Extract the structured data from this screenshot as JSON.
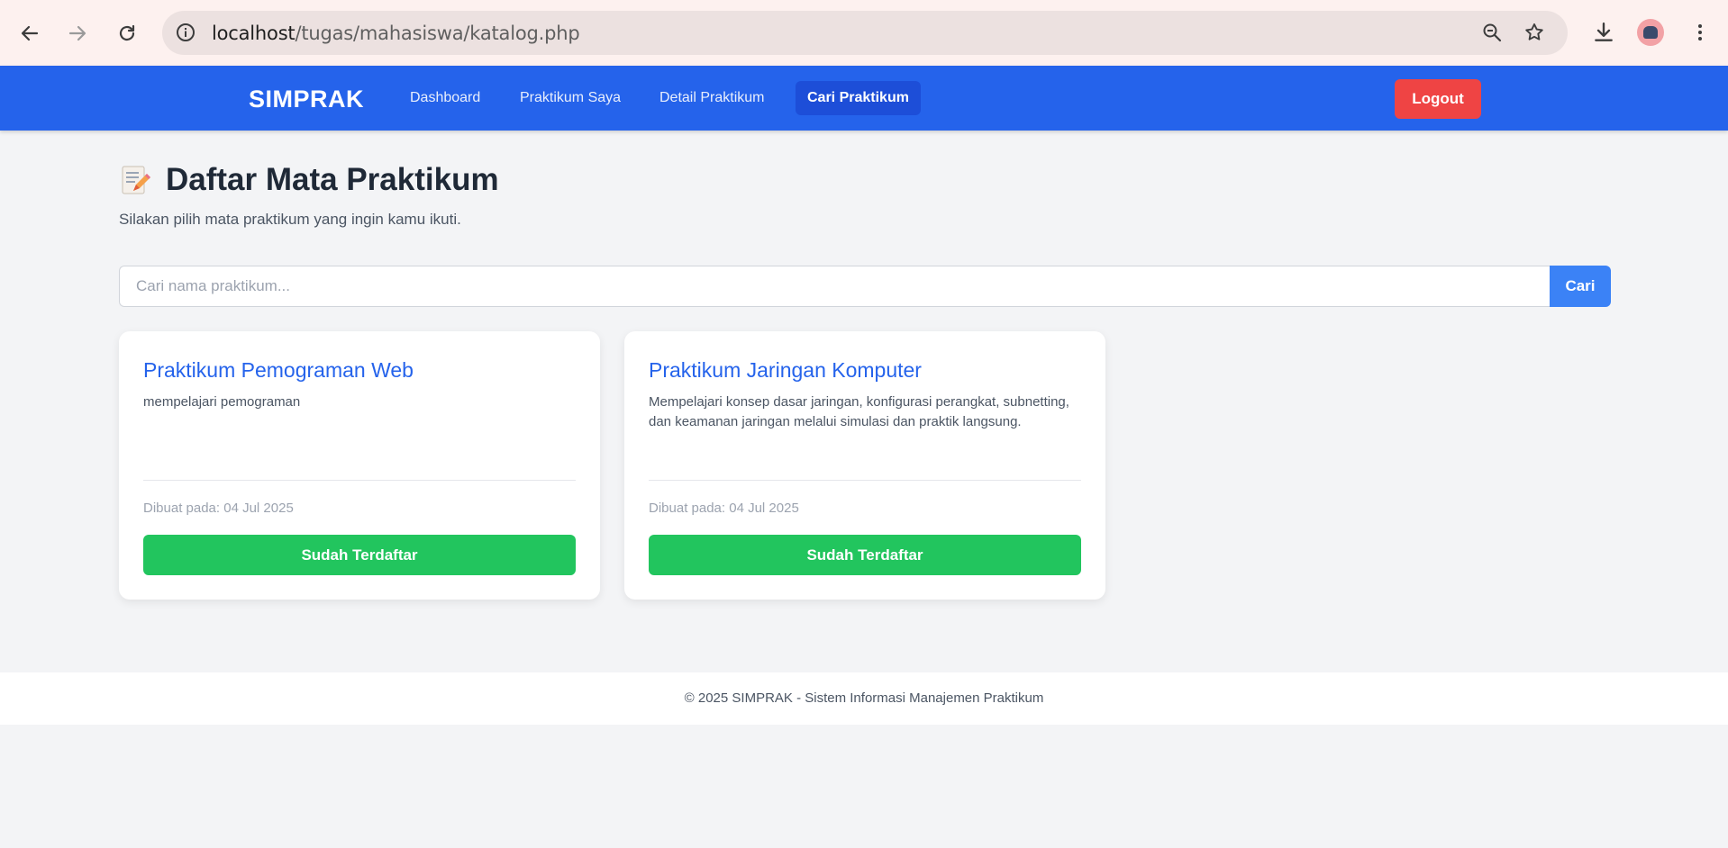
{
  "browser": {
    "url_host": "localhost",
    "url_path": "/tugas/mahasiswa/katalog.php",
    "icons": [
      "back-icon",
      "forward-icon",
      "reload-icon",
      "site-info-icon",
      "zoom-icon",
      "bookmark-star-icon",
      "download-icon",
      "profile-avatar",
      "menu-kebab-icon"
    ]
  },
  "appnav": {
    "brand": "SIMPRAK",
    "links": [
      {
        "label": "Dashboard",
        "active": false
      },
      {
        "label": "Praktikum Saya",
        "active": false
      },
      {
        "label": "Detail Praktikum",
        "active": false
      },
      {
        "label": "Cari Praktikum",
        "active": true
      }
    ],
    "logout_label": "Logout"
  },
  "main": {
    "title": "Daftar Mata Praktikum",
    "title_icon": "memo-icon",
    "subtitle": "Silakan pilih mata praktikum yang ingin kamu ikuti.",
    "search": {
      "placeholder": "Cari nama praktikum...",
      "button_label": "Cari"
    },
    "cards": [
      {
        "title": "Praktikum Pemograman Web",
        "description": "mempelajari pemograman",
        "date": "Dibuat pada: 04 Jul 2025",
        "button_label": "Sudah Terdaftar"
      },
      {
        "title": "Praktikum Jaringan Komputer",
        "description": "Mempelajari konsep dasar jaringan, konfigurasi perangkat, subnetting, dan keamanan jaringan melalui simulasi dan praktik langsung.",
        "date": "Dibuat pada: 04 Jul 2025",
        "button_label": "Sudah Terdaftar"
      }
    ]
  },
  "footer": {
    "text": "© 2025 SIMPRAK - Sistem Informasi Manajemen Praktikum"
  },
  "colors": {
    "nav_bg": "#2563eb",
    "nav_active": "#1d4ed8",
    "logout": "#ef4444",
    "enrolled_button": "#22c55e",
    "search_button": "#3b82f6",
    "card_title": "#2563eb"
  }
}
